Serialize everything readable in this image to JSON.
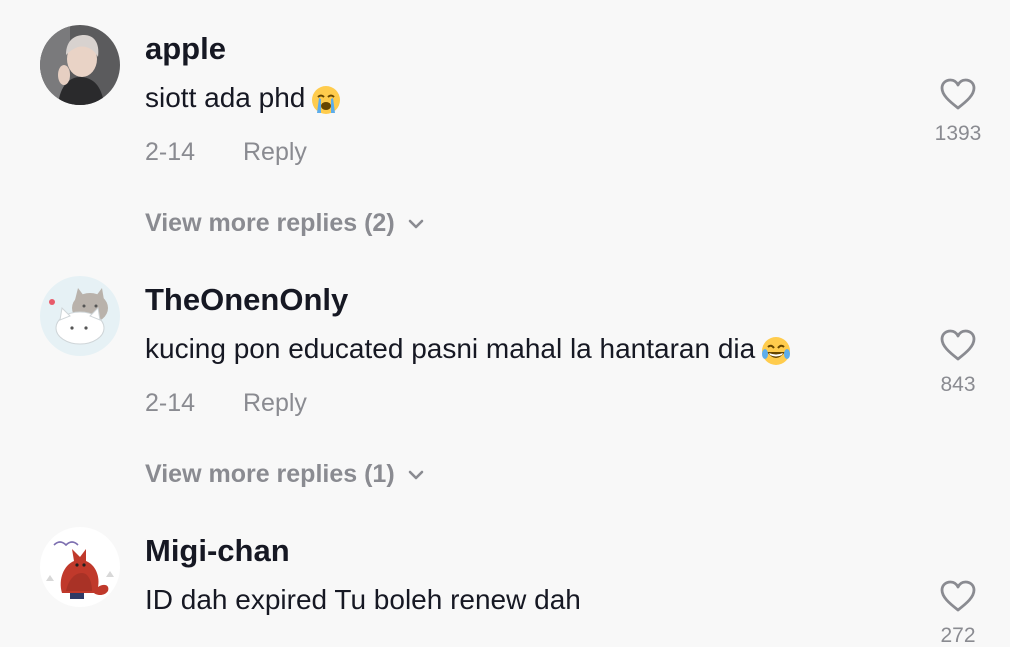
{
  "comments": [
    {
      "username": "apple",
      "text": "siott ada phd",
      "emoji": "loudly-crying-face",
      "date": "2-14",
      "reply_label": "Reply",
      "likes": "1393",
      "more_replies": "View more replies (2)"
    },
    {
      "username": "TheOnenOnly",
      "text": "kucing pon educated pasni mahal la hantaran dia",
      "emoji": "face-with-tears-of-joy",
      "date": "2-14",
      "reply_label": "Reply",
      "likes": "843",
      "more_replies": "View more replies (1)"
    },
    {
      "username": "Migi-chan",
      "text": "ID dah expired Tu boleh renew dah",
      "likes": "272"
    }
  ],
  "icons": {
    "like": "heart-outline-icon",
    "expand": "chevron-down-icon"
  },
  "colors": {
    "background": "#f8f8f8",
    "text_primary": "#161823",
    "text_secondary": "#8a8b91"
  }
}
